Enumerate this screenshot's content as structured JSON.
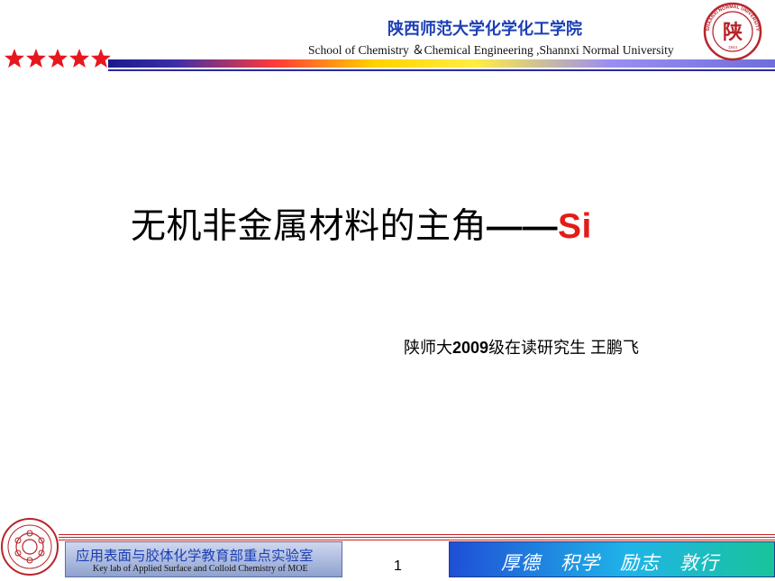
{
  "header": {
    "university_cn": "陕西师范大学化学化工学院",
    "university_en": "School of Chemistry ＆Chemical Engineering ,Shannxi Normal University",
    "seal_glyph": "陕",
    "seal_year": "1944",
    "seal_ring_text": "SHAANXI NORMAL UNIVERSITY",
    "star_color": "#e8161e"
  },
  "slide": {
    "title_main": "无机非金属材料的主角",
    "title_dash": "——",
    "title_si": "Si",
    "title_si_color": "#e41b17",
    "author_prefix": "陕师大",
    "author_year": "2009",
    "author_suffix": "级在读研究生 王鹏飞"
  },
  "footer": {
    "lab_cn": "应用表面与胶体化学教育部重点实验室",
    "lab_en": "Key lab of Applied Surface and Colloid Chemistry of MOE",
    "page_number": "1",
    "motto": "厚德　积学　励志　敦行"
  }
}
